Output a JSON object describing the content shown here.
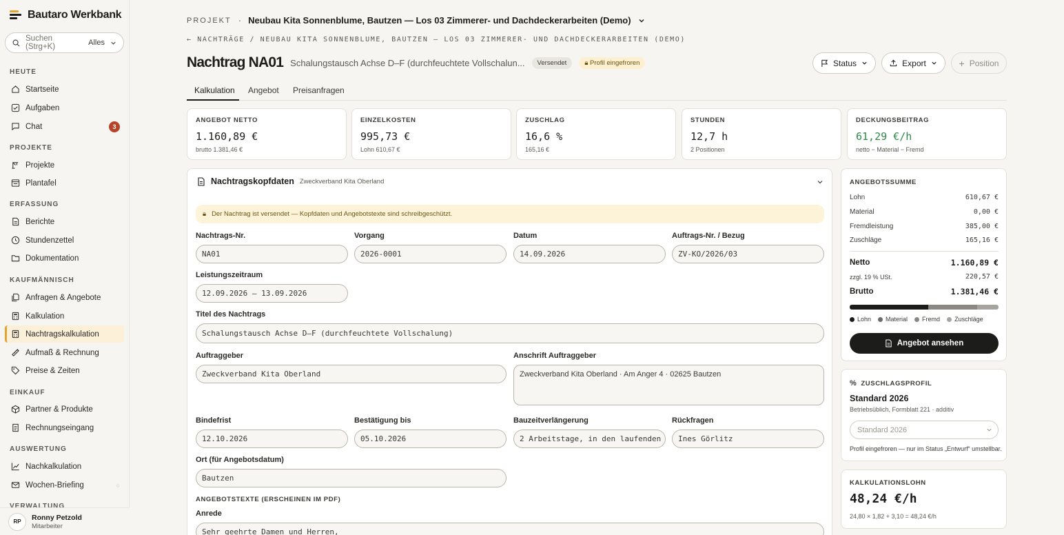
{
  "app": {
    "title": "Bautaro Werkbank"
  },
  "search": {
    "placeholder": "Suchen (Strg+K)",
    "scope": "Alles"
  },
  "nav": {
    "sections": [
      "HEUTE",
      "PROJEKTE",
      "ERFASSUNG",
      "KAUFMÄNNISCH",
      "EINKAUF",
      "AUSWERTUNG",
      "VERWALTUNG"
    ],
    "items": [
      {
        "label": "Startseite",
        "icon": "home-icon"
      },
      {
        "label": "Aufgaben",
        "icon": "check-square-icon"
      },
      {
        "label": "Chat",
        "icon": "chat-icon",
        "badge": "3"
      },
      {
        "label": "Projekte",
        "icon": "crane-icon"
      },
      {
        "label": "Plantafel",
        "icon": "board-icon"
      },
      {
        "label": "Berichte",
        "icon": "document-icon"
      },
      {
        "label": "Stundenzettel",
        "icon": "clock-icon"
      },
      {
        "label": "Dokumentation",
        "icon": "folder-icon"
      },
      {
        "label": "Anfragen & Angebote",
        "icon": "files-icon"
      },
      {
        "label": "Kalkulation",
        "icon": "calculator-icon"
      },
      {
        "label": "Nachtragskalkulation",
        "icon": "calculator-icon"
      },
      {
        "label": "Aufmaß & Rechnung",
        "icon": "ruler-icon"
      },
      {
        "label": "Preise & Zeiten",
        "icon": "tag-icon"
      },
      {
        "label": "Partner & Produkte",
        "icon": "box-icon"
      },
      {
        "label": "Rechnungseingang",
        "icon": "receipt-icon"
      },
      {
        "label": "Nachkalkulation",
        "icon": "chart-line-icon"
      },
      {
        "label": "Wochen-Briefing",
        "icon": "mail-icon"
      }
    ]
  },
  "user": {
    "initials": "RP",
    "name": "Ronny Petzold",
    "role": "Mitarbeiter"
  },
  "header": {
    "project_label": "PROJEKT",
    "project_sep": "·",
    "project_name": "Neubau Kita Sonnenblume, Bautzen — Los 03 Zimmerer- und Dachdeckerarbeiten (Demo)",
    "breadcrumb": "← NACHTRÄGE / NEUBAU KITA SONNENBLUME, BAUTZEN — LOS 03 ZIMMERER- UND DACHDECKERARBEITEN (DEMO)",
    "title": "Nachtrag NA01",
    "subtitle": "Schalungstausch Achse D–F (durchfeuchtete Vollschalun...",
    "status_badge": "Versendet",
    "profile_badge": "Profil eingefroren",
    "buttons": {
      "status": "Status",
      "export": "Export",
      "position": "Position"
    }
  },
  "tabs": [
    "Kalkulation",
    "Angebot",
    "Preisanfragen"
  ],
  "kpis": [
    {
      "label": "ANGEBOT NETTO",
      "value": "1.160,89 €",
      "sub": "brutto 1.381,46 €"
    },
    {
      "label": "EINZELKOSTEN",
      "value": "995,73 €",
      "sub": "Lohn 610,67 €"
    },
    {
      "label": "ZUSCHLAG",
      "value": "16,6 %",
      "sub": "165,16 €"
    },
    {
      "label": "STUNDEN",
      "value": "12,7 h",
      "sub": "2 Positionen"
    },
    {
      "label": "DECKUNGSBEITRAG",
      "value": "61,29 €/h",
      "sub": "netto − Material − Fremd",
      "color": "#2f8a4a"
    }
  ],
  "form": {
    "title": "Nachtragskopfdaten",
    "subtitle": "Zweckverband Kita Oberland",
    "notice": "Der Nachtrag ist versendet — Kopfdaten und Angebotstexte sind schreibgeschützt.",
    "fields": {
      "nr": {
        "label": "Nachtrags-Nr.",
        "value": "NA01"
      },
      "vorgang": {
        "label": "Vorgang",
        "value": "2026-0001"
      },
      "datum": {
        "label": "Datum",
        "value": "14.09.2026"
      },
      "auftrag": {
        "label": "Auftrags-Nr. / Bezug",
        "value": "ZV-KO/2026/03"
      },
      "zeitraum": {
        "label": "Leistungszeitraum",
        "value": "12.09.2026 – 13.09.2026"
      },
      "titel": {
        "label": "Titel des Nachtrags",
        "value": "Schalungstausch Achse D–F (durchfeuchtete Vollschalung)"
      },
      "auftraggeber": {
        "label": "Auftraggeber",
        "value": "Zweckverband Kita Oberland"
      },
      "anschrift": {
        "label": "Anschrift Auftraggeber",
        "value": "Zweckverband Kita Oberland · Am Anger 4 · 02625 Bautzen"
      },
      "bindefrist": {
        "label": "Bindefrist",
        "value": "12.10.2026"
      },
      "bestaetigung": {
        "label": "Bestätigung bis",
        "value": "05.10.2026"
      },
      "bauzeit": {
        "label": "Bauzeitverlängerung",
        "value": "2 Arbeitstage, in den laufenden"
      },
      "rueckfragen": {
        "label": "Rückfragen",
        "value": "Ines Görlitz"
      },
      "ort": {
        "label": "Ort (für Angebotsdatum)",
        "value": "Bautzen"
      }
    },
    "texts_section": "ANGEBOTSTEXTE (ERSCHEINEN IM PDF)",
    "anrede": {
      "label": "Anrede",
      "value": "Sehr geehrte Damen und Herren,"
    }
  },
  "summary": {
    "label": "ANGEBOTSSUMME",
    "rows": [
      {
        "label": "Lohn",
        "value": "610,67 €"
      },
      {
        "label": "Material",
        "value": "0,00 €"
      },
      {
        "label": "Fremdleistung",
        "value": "385,00 €"
      },
      {
        "label": "Zuschläge",
        "value": "165,16 €"
      }
    ],
    "netto": {
      "label": "Netto",
      "value": "1.160,89 €"
    },
    "ust": {
      "label": "zzgl. 19 % USt.",
      "value": "220,57 €"
    },
    "brutto": {
      "label": "Brutto",
      "value": "1.381,46 €"
    },
    "bar_shares": [
      {
        "name": "Lohn",
        "value": 610.67,
        "color": "#1c1c1a"
      },
      {
        "name": "Material",
        "value": 0,
        "color": "#6e6c66"
      },
      {
        "name": "Fremd",
        "value": 385.0,
        "color": "#8a8882"
      },
      {
        "name": "Zuschläge",
        "value": 165.16,
        "color": "#a6a49e"
      }
    ],
    "button": "Angebot ansehen"
  },
  "profile": {
    "label": "ZUSCHLAGSPROFIL",
    "name": "Standard 2026",
    "desc": "Betriebsüblich, Formblatt 221 · additiv",
    "select": "Standard 2026",
    "note": "Profil eingefroren — nur im Status „Entwurf“ umstellbar."
  },
  "wage": {
    "label": "KALKULATIONSLOHN",
    "value": "48,24 €/h",
    "formula": "24,80 × 1,82 + 3,10 = 48,24 €/h"
  }
}
